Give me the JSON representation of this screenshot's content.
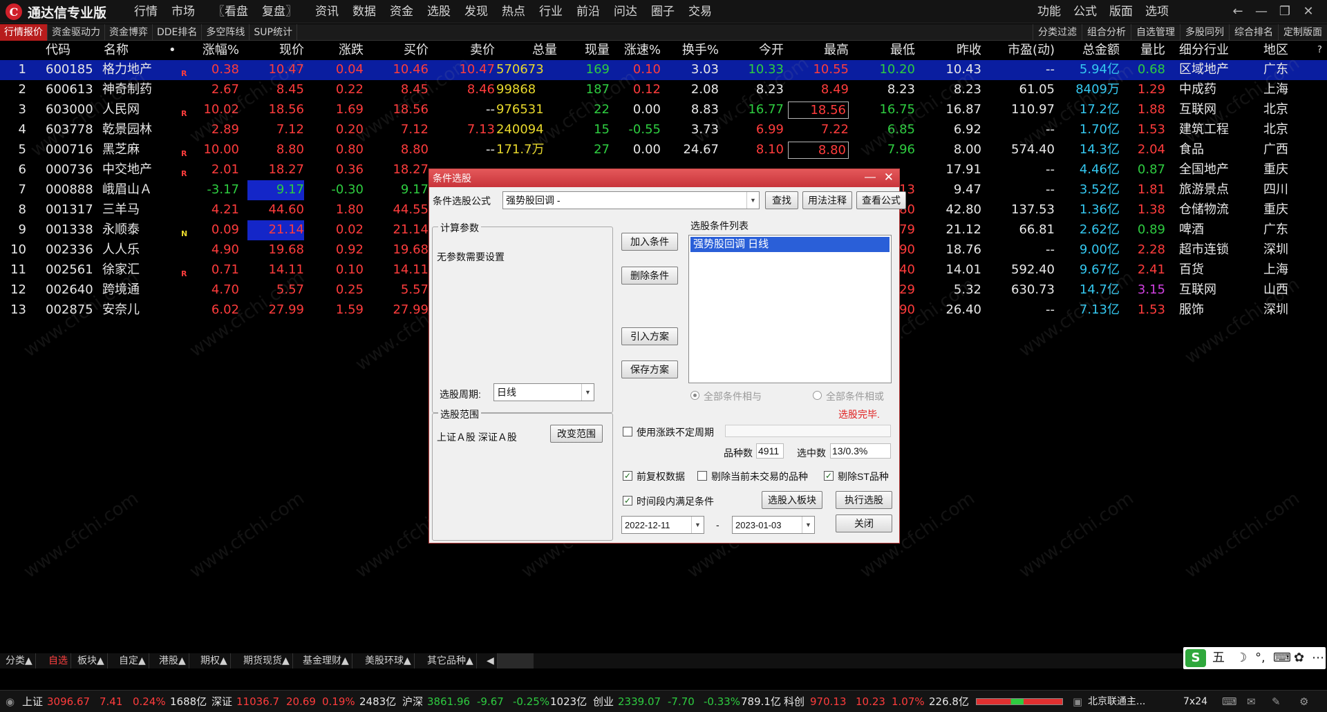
{
  "app": {
    "title": "通达信专业版",
    "logo_glyph": "C"
  },
  "menus": [
    "行情",
    "市场",
    "〖看盘",
    "复盘〗",
    "资讯",
    "数据",
    "资金",
    "选股",
    "发现",
    "热点",
    "行业",
    "前沿",
    "问达",
    "圈子",
    "交易"
  ],
  "right_menus": [
    "功能",
    "公式",
    "版面",
    "选项"
  ],
  "window_controls": {
    "back": "←",
    "minimize": "—",
    "restore": "❐",
    "close": "✕"
  },
  "left_tabs": [
    "行情报价",
    "资金驱动力",
    "资金博弈",
    "DDE排名",
    "多空阵线",
    "SUP统计"
  ],
  "right_tabs": [
    "分类过滤",
    "组合分析",
    "自选管理",
    "多股同列",
    "综合排名",
    "定制版面"
  ],
  "table": {
    "headers": [
      "代码",
      "名称",
      "•",
      "涨幅%",
      "现价",
      "涨跌",
      "买价",
      "卖价",
      "总量",
      "现量",
      "涨速%",
      "换手%",
      "今开",
      "最高",
      "最低",
      "昨收",
      "市盈(动)",
      "总金额",
      "量比",
      "细分行业",
      "地区"
    ],
    "corner_mark": "?",
    "rows": [
      {
        "n": "1",
        "code": "600185",
        "name": "格力地产",
        "flag": "R",
        "zf": "0.38",
        "xj": "10.47",
        "zd": "0.04",
        "mj": "10.46",
        "sj": "10.47",
        "zl": "570673",
        "xl": "169",
        "zs": "0.10",
        "hs": "3.03",
        "jk": "10.33",
        "zg": "10.55",
        "zdi": "10.20",
        "zs2": "10.43",
        "syl": "--",
        "zje": "5.94亿",
        "lb": "0.68",
        "hy": "区域地产",
        "dq": "广东"
      },
      {
        "n": "2",
        "code": "600613",
        "name": "神奇制药",
        "flag": "",
        "zf": "2.67",
        "xj": "8.45",
        "zd": "0.22",
        "mj": "8.45",
        "sj": "8.46",
        "zl": "99868",
        "xl": "187",
        "zs": "0.12",
        "hs": "2.08",
        "jk": "8.23",
        "zg": "8.49",
        "zdi": "8.23",
        "zs2": "8.23",
        "syl": "61.05",
        "zje": "8409万",
        "lb": "1.29",
        "hy": "中成药",
        "dq": "上海"
      },
      {
        "n": "3",
        "code": "603000",
        "name": "人民网",
        "flag": "R",
        "zf": "10.02",
        "xj": "18.56",
        "zd": "1.69",
        "mj": "18.56",
        "sj": "--",
        "zl": "976531",
        "xl": "22",
        "zs": "0.00",
        "hs": "8.83",
        "jk": "16.77",
        "zg": "18.56",
        "zdi": "16.75",
        "zs2": "16.87",
        "syl": "110.97",
        "zje": "17.2亿",
        "lb": "1.88",
        "hy": "互联网",
        "dq": "北京"
      },
      {
        "n": "4",
        "code": "603778",
        "name": "乾景园林",
        "flag": "",
        "zf": "2.89",
        "xj": "7.12",
        "zd": "0.20",
        "mj": "7.12",
        "sj": "7.13",
        "zl": "240094",
        "xl": "15",
        "zs": "-0.55",
        "hs": "3.73",
        "jk": "6.99",
        "zg": "7.22",
        "zdi": "6.85",
        "zs2": "6.92",
        "syl": "--",
        "zje": "1.70亿",
        "lb": "1.53",
        "hy": "建筑工程",
        "dq": "北京"
      },
      {
        "n": "5",
        "code": "000716",
        "name": "黑芝麻",
        "flag": "R",
        "zf": "10.00",
        "xj": "8.80",
        "zd": "0.80",
        "mj": "8.80",
        "sj": "--",
        "zl": "171.7万",
        "xl": "27",
        "zs": "0.00",
        "hs": "24.67",
        "jk": "8.10",
        "zg": "8.80",
        "zdi": "7.96",
        "zs2": "8.00",
        "syl": "574.40",
        "zje": "14.3亿",
        "lb": "2.04",
        "hy": "食品",
        "dq": "广西"
      },
      {
        "n": "6",
        "code": "000736",
        "name": "中交地产",
        "flag": "R",
        "zf": "2.01",
        "xj": "18.27",
        "zd": "0.36",
        "mj": "18.27",
        "sj": "",
        "zl": "",
        "xl": "",
        "zs": "",
        "hs": "",
        "jk": "",
        "zg": "",
        "zdi": "",
        "zs2": "17.91",
        "syl": "--",
        "zje": "4.46亿",
        "lb": "0.87",
        "hy": "全国地产",
        "dq": "重庆"
      },
      {
        "n": "7",
        "code": "000888",
        "name": "峨眉山Ａ",
        "flag": "",
        "zf": "-3.17",
        "xj": "9.17",
        "zd": "-0.30",
        "mj": "9.17",
        "sj": "",
        "zl": "",
        "xl": "",
        "zs": "",
        "hs": "",
        "jk": "",
        "zg": "",
        "zdi": "13",
        "zs2": "9.47",
        "syl": "--",
        "zje": "3.52亿",
        "lb": "1.81",
        "hy": "旅游景点",
        "dq": "四川"
      },
      {
        "n": "8",
        "code": "001317",
        "name": "三羊马",
        "flag": "",
        "zf": "4.21",
        "xj": "44.60",
        "zd": "1.80",
        "mj": "44.55",
        "sj": "",
        "zl": "",
        "xl": "",
        "zs": "",
        "hs": "",
        "jk": "",
        "zg": "",
        "zdi": "80",
        "zs2": "42.80",
        "syl": "137.53",
        "zje": "1.36亿",
        "lb": "1.38",
        "hy": "仓储物流",
        "dq": "重庆"
      },
      {
        "n": "9",
        "code": "001338",
        "name": "永顺泰",
        "flag": "N",
        "zf": "0.09",
        "xj": "21.14",
        "zd": "0.02",
        "mj": "21.14",
        "sj": "",
        "zl": "",
        "xl": "",
        "zs": "",
        "hs": "",
        "jk": "",
        "zg": "",
        "zdi": "79",
        "zs2": "21.12",
        "syl": "66.81",
        "zje": "2.62亿",
        "lb": "0.89",
        "hy": "啤酒",
        "dq": "广东"
      },
      {
        "n": "10",
        "code": "002336",
        "name": "人人乐",
        "flag": "",
        "zf": "4.90",
        "xj": "19.68",
        "zd": "0.92",
        "mj": "19.68",
        "sj": "",
        "zl": "",
        "xl": "",
        "zs": "",
        "hs": "",
        "jk": "",
        "zg": "",
        "zdi": "90",
        "zs2": "18.76",
        "syl": "--",
        "zje": "9.00亿",
        "lb": "2.28",
        "hy": "超市连锁",
        "dq": "深圳"
      },
      {
        "n": "11",
        "code": "002561",
        "name": "徐家汇",
        "flag": "R",
        "zf": "0.71",
        "xj": "14.11",
        "zd": "0.10",
        "mj": "14.11",
        "sj": "",
        "zl": "",
        "xl": "",
        "zs": "",
        "hs": "",
        "jk": "",
        "zg": "",
        "zdi": "40",
        "zs2": "14.01",
        "syl": "592.40",
        "zje": "9.67亿",
        "lb": "2.41",
        "hy": "百货",
        "dq": "上海"
      },
      {
        "n": "12",
        "code": "002640",
        "name": "跨境通",
        "flag": "",
        "zf": "4.70",
        "xj": "5.57",
        "zd": "0.25",
        "mj": "5.57",
        "sj": "",
        "zl": "",
        "xl": "",
        "zs": "",
        "hs": "",
        "jk": "",
        "zg": "",
        "zdi": "29",
        "zs2": "5.32",
        "syl": "630.73",
        "zje": "14.7亿",
        "lb": "3.15",
        "hy": "互联网",
        "dq": "山西"
      },
      {
        "n": "13",
        "code": "002875",
        "name": "安奈儿",
        "flag": "",
        "zf": "6.02",
        "xj": "27.99",
        "zd": "1.59",
        "mj": "27.99",
        "sj": "",
        "zl": "",
        "xl": "",
        "zs": "",
        "hs": "",
        "jk": "",
        "zg": "",
        "zdi": "90",
        "zs2": "26.40",
        "syl": "--",
        "zje": "7.13亿",
        "lb": "1.53",
        "hy": "服饰",
        "dq": "深圳"
      }
    ]
  },
  "dialog": {
    "title": "条件选股",
    "min_glyph": "—",
    "close_glyph": "✕",
    "formula_label": "条件选股公式",
    "formula_value": "强势股回调  -",
    "find_btn": "查找",
    "usage_btn": "用法注释",
    "view_btn": "查看公式",
    "params_group": "计算参数",
    "params_text": "无参数需要设置",
    "period_label": "选股周期:",
    "period_value": "日线",
    "add_btn": "加入条件",
    "del_btn": "删除条件",
    "import_btn": "引入方案",
    "save_btn": "保存方案",
    "list_label": "选股条件列表",
    "list_items": [
      "强势股回调  日线"
    ],
    "and_label": "全部条件相与",
    "or_label": "全部条件相或",
    "done_text": "选股完毕.",
    "range_group": "选股范围",
    "range_text": "上证Ａ股 深证Ａ股",
    "range_btn": "改变范围",
    "indef_label": "使用涨跌不定周期",
    "count_label": "品种数",
    "count_value": "4911",
    "selected_label": "选中数",
    "selected_value": "13/0.3%",
    "fq_label": "前复权数据",
    "exclude_notrade_label": "剔除当前未交易的品种",
    "exclude_st_label": "剔除ST品种",
    "period_satisfy_label": "时间段内满足条件",
    "to_block_btn": "选股入板块",
    "exec_btn": "执行选股",
    "date_from": "2022-12-11",
    "date_sep": "-",
    "date_to": "2023-01-03",
    "close_btn": "关闭"
  },
  "bottom_tabs": [
    "分类▲",
    "自选",
    "板块▲",
    "自定▲",
    "港股▲",
    "期权▲",
    "期货现货▲",
    "基金理财▲",
    "美股环球▲",
    "其它品种▲",
    "◀"
  ],
  "ime": {
    "logo": "S",
    "keys": [
      "五",
      "☽",
      "°,",
      "⌨",
      "✿",
      "⋯"
    ]
  },
  "status_bar": {
    "sh_label": "上证",
    "sh_val": "3096.67",
    "sh_chg": "7.41",
    "sh_pct": "0.24%",
    "sh_amt": "1688亿",
    "sz_label": "深证",
    "sz_val": "11036.7",
    "sz_chg": "20.69",
    "sz_pct": "0.19%",
    "sz_amt": "2483亿",
    "hs_label": "沪深",
    "hs_val": "3861.96",
    "hs_chg": "-9.67",
    "hs_pct": "-0.25%",
    "hs_amt": "1023亿",
    "cy_label": "创业",
    "cy_val": "2339.07",
    "cy_chg": "-7.70",
    "cy_pct": "-0.33%",
    "cy_amt": "789.1亿",
    "kc_label": "科创",
    "kc_val": "970.13",
    "kc_chg": "10.23",
    "kc_pct": "1.07%",
    "kc_amt": "226.8亿",
    "server": "北京联通主...",
    "service": "7x24"
  },
  "watermark": "www.cfchi.com",
  "colors": {
    "up": "#ff3c3c",
    "down": "#2ecc40",
    "selected_row": "#0a1ea0",
    "accent": "#b71c1c"
  }
}
